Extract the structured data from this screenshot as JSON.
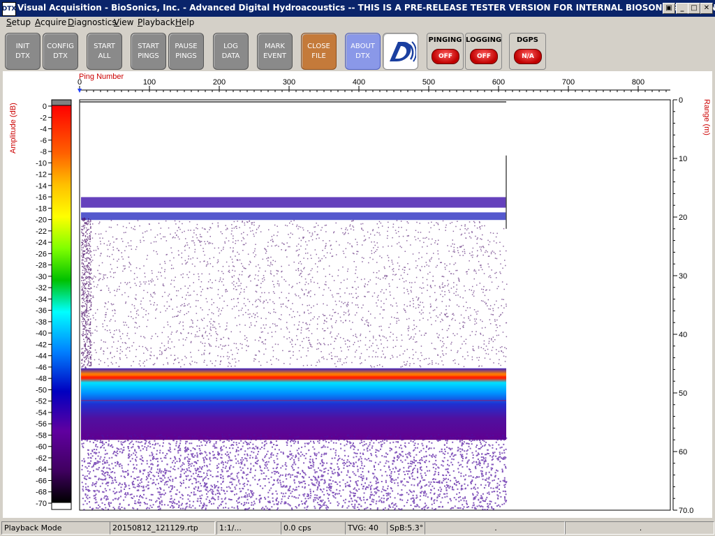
{
  "window": {
    "icon_label": "DTX",
    "title": "Visual Acquisition  -  BioSonics, Inc.  -  Advanced Digital Hydroacoustics  -- THIS IS A PRE-RELEASE TESTER VERSION FOR INTERNAL BIOSONICS USE ONLY",
    "buttons": [
      "▣",
      "_",
      "□",
      "✕"
    ]
  },
  "menu": [
    {
      "underline": "S",
      "rest": "etup"
    },
    {
      "underline": "A",
      "rest": "cquire"
    },
    {
      "underline": "D",
      "rest": "iagnostics"
    },
    {
      "underline": "V",
      "rest": "iew"
    },
    {
      "underline": "P",
      "rest": "layback"
    },
    {
      "underline": "H",
      "rest": "elp"
    }
  ],
  "toolbar": {
    "buttons": [
      {
        "id": "init-dtx",
        "label": "INIT\nDTX"
      },
      {
        "id": "config-dtx",
        "label": "CONFIG\nDTX"
      },
      {
        "id": "start-all",
        "label": "START\nALL"
      },
      {
        "id": "start-pings",
        "label": "START\nPINGS"
      },
      {
        "id": "pause-pings",
        "label": "PAUSE\nPINGS"
      },
      {
        "id": "log-data",
        "label": "LOG\nDATA"
      },
      {
        "id": "mark-event",
        "label": "MARK\nEVENT"
      },
      {
        "id": "close-file",
        "label": "CLOSE\nFILE"
      },
      {
        "id": "about-dtx",
        "label": "ABOUT\nDTX"
      }
    ],
    "status": [
      {
        "label": "PINGING",
        "value": "OFF"
      },
      {
        "label": "LOGGING",
        "value": "OFF"
      },
      {
        "label": "DGPS",
        "value": "N/A"
      }
    ]
  },
  "echogram": {
    "x_axis_title": "Ping Number",
    "x_ticks": [
      "0",
      "100",
      "200",
      "300",
      "400",
      "500",
      "600",
      "700",
      "800"
    ],
    "y_axis_title": "Range (m)",
    "y_ticks": [
      "0",
      "10",
      "20",
      "30",
      "40",
      "50",
      "60",
      "70.0"
    ],
    "color_scale_title": "Amplitude (dB)",
    "color_scale_ticks": [
      "0",
      "-2",
      "-4",
      "-6",
      "-8",
      "-10",
      "-12",
      "-14",
      "-16",
      "-18",
      "-20",
      "-22",
      "-24",
      "-26",
      "-28",
      "-30",
      "-32",
      "-34",
      "-36",
      "-38",
      "-40",
      "-42",
      "-44",
      "-46",
      "-48",
      "-50",
      "-52",
      "-54",
      "-56",
      "-58",
      "-60",
      "-62",
      "-64",
      "-66",
      "-68",
      "-70"
    ],
    "colors": {
      "accent_red": "#cc0000",
      "axis": "#000000"
    }
  },
  "statusbar": {
    "mode": "Playback Mode",
    "file": "20150812_121129.rtp",
    "ratio": "1:1/...",
    "cps": "0.0 cps",
    "tvg": "TVG: 40",
    "spb": "SpB:5.3°",
    "field7": ".",
    "field8": "."
  }
}
